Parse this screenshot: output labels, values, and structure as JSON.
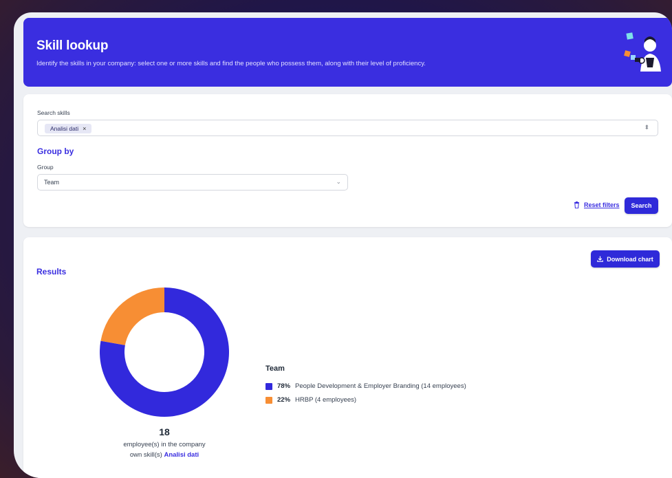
{
  "header": {
    "title": "Skill lookup",
    "subtitle": "Identify the skills in your company: select one or more skills and find the people who possess them, along with their level of proficiency."
  },
  "filters": {
    "search_skills_label": "Search skills",
    "selected_skills": [
      "Analisi dati"
    ],
    "chip_remove": "×",
    "group_by_heading": "Group by",
    "group_label": "Group",
    "group_value": "Team",
    "reset_label": "Reset filters",
    "search_button": "Search"
  },
  "results": {
    "heading": "Results",
    "download_button": "Download chart",
    "total_employees": "18",
    "summary_line1": "employee(s) in the company",
    "summary_line2_prefix": "own skill(s)",
    "summary_skill": "Analisi dati",
    "legend_title": "Team"
  },
  "colors": {
    "primary": "#3a2ee0",
    "series_1": "#3229dc",
    "series_2": "#f78e34"
  },
  "chart_data": {
    "type": "pie",
    "title": "Team",
    "categories": [
      "People Development & Employer Branding",
      "HRBP"
    ],
    "values": [
      14,
      4
    ],
    "percent_labels": [
      "78%",
      "22%"
    ],
    "descriptions": [
      "People Development & Employer Branding (14 employees)",
      "HRBP (4 employees)"
    ],
    "colors": [
      "#3229dc",
      "#f78e34"
    ],
    "legend_position": "right"
  }
}
